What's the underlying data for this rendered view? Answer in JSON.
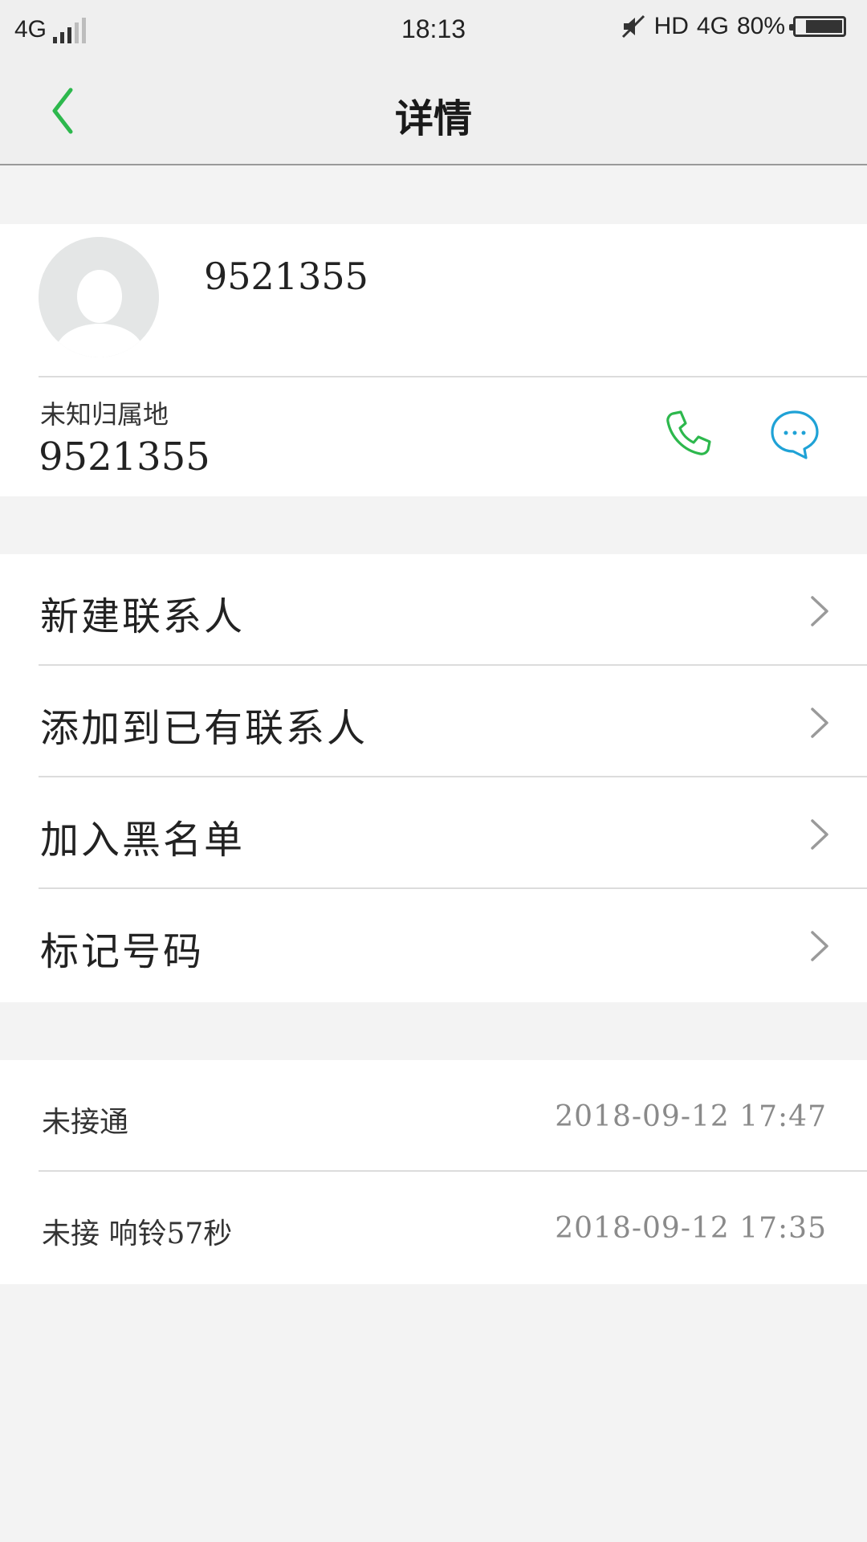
{
  "status_bar": {
    "network": "4G",
    "time": "18:13",
    "hd": "HD",
    "network_right": "4G",
    "battery": "80%",
    "battery_level": 0.8
  },
  "header": {
    "title": "详情",
    "back_icon": "chevron-left-icon"
  },
  "contact": {
    "name": "9521355",
    "location": "未知归属地",
    "number": "9521355",
    "avatar_icon": "person-placeholder-icon",
    "call_icon": "phone-icon",
    "message_icon": "message-bubble-icon"
  },
  "actions": [
    {
      "label": "新建联系人"
    },
    {
      "label": "添加到已有联系人"
    },
    {
      "label": "加入黑名单"
    },
    {
      "label": "标记号码"
    }
  ],
  "call_log": [
    {
      "status": "未接通",
      "datetime": "2018-09-12  17:47"
    },
    {
      "status": "未接  响铃57秒",
      "datetime": "2018-09-12  17:35"
    }
  ],
  "colors": {
    "accent_green": "#2db84d",
    "accent_blue": "#1fa2d6",
    "background": "#f3f3f3"
  }
}
